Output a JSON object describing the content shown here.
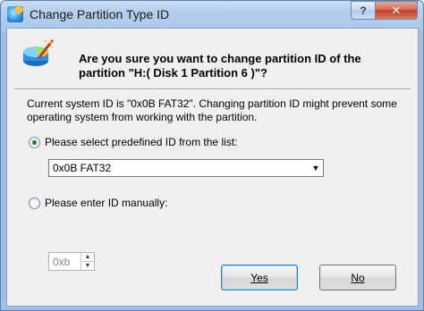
{
  "window": {
    "title": "Change Partition Type ID",
    "help_label": "?",
    "close_label": "✕"
  },
  "question": {
    "text": "Are you sure you want to change partition ID of the partition \"H:( Disk 1 Partition 6 )\"?"
  },
  "info": {
    "text": "Current system ID is \"0x0B FAT32\". Changing partition ID might prevent some operating system from working with the partition."
  },
  "option_predefined": {
    "label": "Please select predefined ID from the list:",
    "checked": true,
    "selected_value": "0x0B FAT32"
  },
  "option_manual": {
    "label": "Please enter ID manually:",
    "checked": false,
    "value": "0xb"
  },
  "buttons": {
    "yes_label": "Yes",
    "no_label": "No"
  },
  "icons": {
    "app": "partition-wizard-icon",
    "question": "partition-wizard-icon"
  },
  "colors": {
    "title_bar": "#a9c6ea",
    "close": "#c23b22",
    "radio_dot": "#2b7a2b"
  }
}
